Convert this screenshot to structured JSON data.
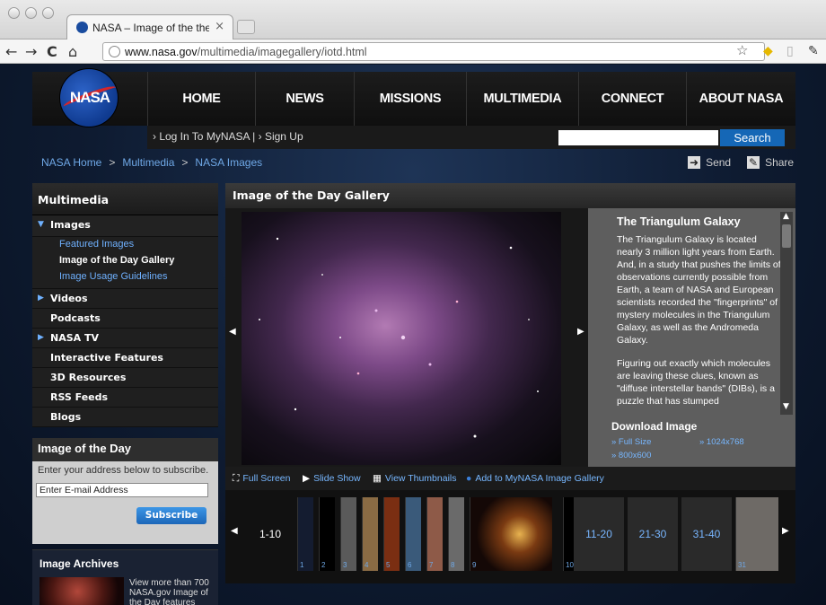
{
  "browser": {
    "tab_title": "NASA – Image of the the Day",
    "tab_close": "×",
    "url_host": "www.nasa.gov",
    "url_path": "/multimedia/imagegallery/iotd.html"
  },
  "header": {
    "logo_text": "NASA",
    "nav": [
      "HOME",
      "NEWS",
      "MISSIONS",
      "MULTIMEDIA",
      "CONNECT",
      "ABOUT NASA"
    ],
    "login_text": "› Log In To MyNASA  |  › Sign Up",
    "search_label": "Search"
  },
  "breadcrumb": {
    "items": [
      "NASA Home",
      "Multimedia",
      "NASA Images"
    ],
    "sep": ">",
    "send": "Send",
    "share": "Share"
  },
  "sidebar": {
    "title": "Multimedia",
    "images_label": "Images",
    "sub_items": [
      "Featured Images",
      "Image of the Day Gallery",
      "Image Usage Guidelines"
    ],
    "items": [
      "Videos",
      "Podcasts",
      "NASA TV",
      "Interactive Features",
      "3D Resources",
      "RSS Feeds",
      "Blogs"
    ],
    "iotd": {
      "title": "Image of the Day",
      "text": "Enter your address below to subscribe.",
      "email_value": "Enter E-mail Address",
      "subscribe_label": "Subscribe"
    },
    "archives": {
      "title": "Image Archives",
      "text": "View more than 700 NASA.gov Image of the Day features"
    }
  },
  "gallery": {
    "title": "Image of the Day Gallery",
    "image_title": "The Triangulum Galaxy",
    "desc_p1": "The Triangulum Galaxy is located nearly 3 million light years from Earth. And, in a study that pushes the limits of observations currently possible from Earth, a team of NASA and European scientists recorded the \"fingerprints\" of mystery molecules in the Triangulum Galaxy, as well as the Andromeda Galaxy.",
    "desc_p2": "Figuring out exactly which molecules are leaving these clues, known as \"diffuse interstellar bands\" (DIBs), is a puzzle that has stumped",
    "download_title": "Download Image",
    "download_links": [
      "» Full Size",
      "» 1024x768",
      "» 800x600"
    ],
    "tools": [
      "Full Screen",
      "Slide Show",
      "View Thumbnails",
      "Add to MyNASA Image Gallery"
    ],
    "pages": [
      "1-10",
      "11-20",
      "21-30",
      "31-40"
    ],
    "thumb_numbers": [
      "1",
      "2",
      "3",
      "4",
      "5",
      "6",
      "7",
      "8",
      "9",
      "10",
      "31"
    ]
  }
}
